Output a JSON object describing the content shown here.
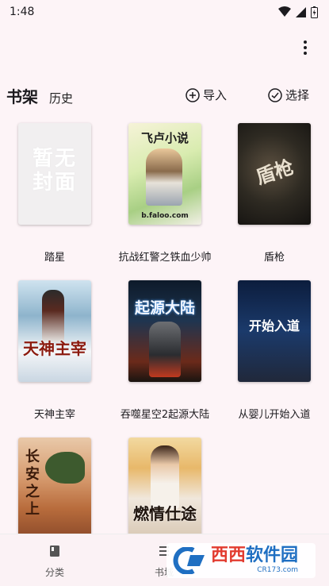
{
  "status": {
    "time": "1:48"
  },
  "header": {
    "tabs": [
      {
        "label": "书架"
      },
      {
        "label": "历史"
      }
    ],
    "import_label": "导入",
    "select_label": "选择"
  },
  "books": [
    {
      "title": "踏星",
      "cover_text": "暂无封面"
    },
    {
      "title": "抗战红警之铁血少帅",
      "cover_text": "飞卢小说",
      "cover_sub": "b.faloo.com"
    },
    {
      "title": "盾枪",
      "cover_text": "盾枪"
    },
    {
      "title": "天神主宰",
      "cover_text": "天神主宰"
    },
    {
      "title": "吞噬星空2起源大陆",
      "cover_text": "起源大陆"
    },
    {
      "title": "从婴儿开始入道",
      "cover_text": "开始入道"
    },
    {
      "title": "",
      "cover_text": "长安之上"
    },
    {
      "title": "",
      "cover_text": "燃情仕途"
    }
  ],
  "bottom_nav": [
    {
      "label": "分类"
    },
    {
      "label": "书城"
    }
  ],
  "watermark": {
    "text_a": "西西",
    "text_b": "软件园",
    "domain": "CR173.com"
  },
  "colors": {
    "background": "#fdf4f7",
    "accent": "#1f6fc2"
  }
}
